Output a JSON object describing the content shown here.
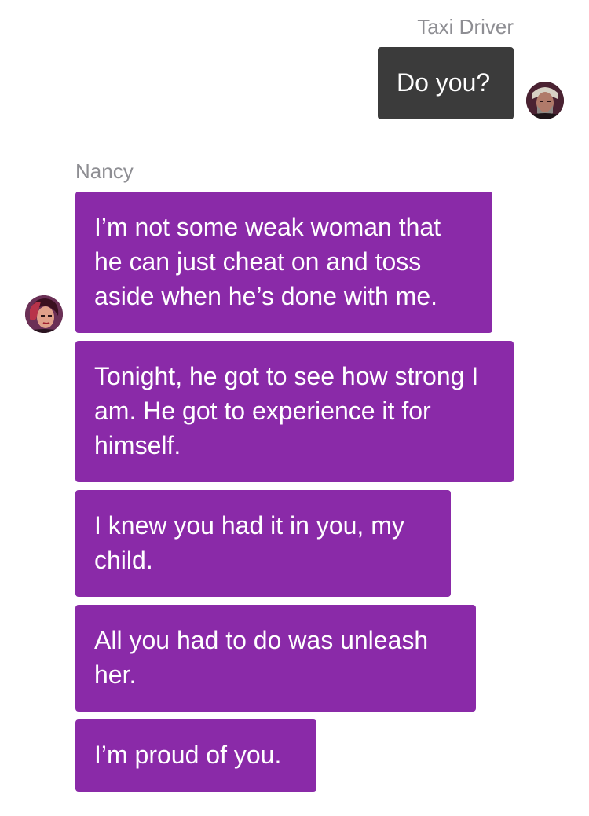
{
  "conversation": {
    "outgoing_group": {
      "sender": "Taxi Driver",
      "avatar_icon": "taxi-driver-portrait-icon",
      "bubble_color": "#3b3b3b",
      "messages": [
        "Do you?"
      ]
    },
    "incoming_group": {
      "sender": "Nancy",
      "avatar_icon": "nancy-portrait-icon",
      "bubble_color": "#8a2aa8",
      "messages": [
        "I’m not some weak woman that he can just cheat on and toss aside when he’s done with me.",
        "Tonight, he got to see how strong I am. He got to experience it for himself.",
        "I knew you had it in you, my child.",
        "All you had to do was unleash her.",
        "I’m proud of you."
      ]
    }
  }
}
